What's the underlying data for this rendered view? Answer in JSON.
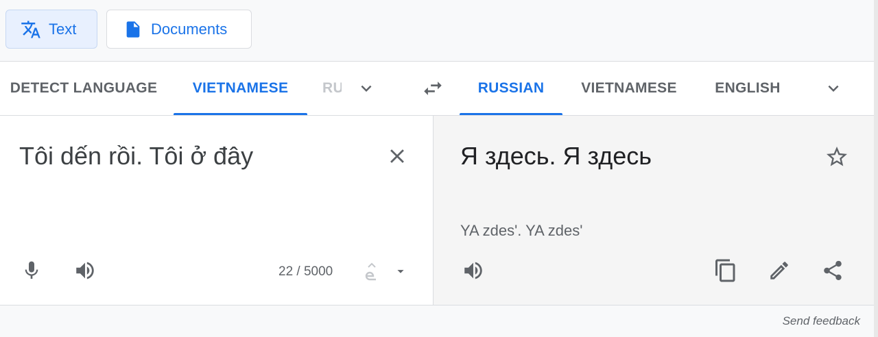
{
  "mode_tabs": {
    "text_label": "Text",
    "documents_label": "Documents"
  },
  "source_langs": {
    "detect": "DETECT LANGUAGE",
    "selected": "VIETNAMESE",
    "partial": "RU"
  },
  "target_langs": {
    "selected": "RUSSIAN",
    "second": "VIETNAMESE",
    "third": "ENGLISH"
  },
  "source": {
    "text": "Tôi dến rồi. Tôi ở đây",
    "char_count": "22 / 5000"
  },
  "target": {
    "text": "Я здесь. Я здесь",
    "transliteration": "YA zdes'. YA zdes'"
  },
  "footer": {
    "send_feedback": "Send feedback"
  },
  "colors": {
    "accent": "#1a73e8",
    "icon": "#5f6368",
    "target_bg": "#f5f5f5"
  },
  "icons": [
    "translate-icon",
    "document-icon",
    "chevron-down-icon",
    "swap-icon",
    "close-icon",
    "star-icon",
    "mic-icon",
    "speaker-icon",
    "ime-icon",
    "caret-down-icon",
    "copy-icon",
    "edit-icon",
    "share-icon"
  ]
}
